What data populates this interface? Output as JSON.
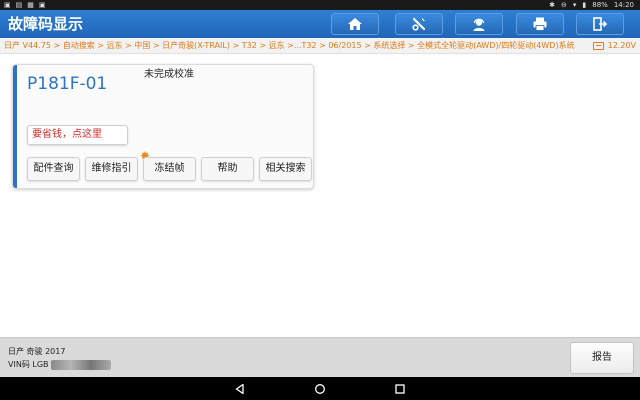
{
  "status_bar": {
    "left_icons": [
      "notification-icon",
      "screenshot-icon",
      "image-icon",
      "notification-icon"
    ],
    "battery_percent": "88%",
    "time": "14:20"
  },
  "header": {
    "title": "故障码显示",
    "buttons": [
      "home-icon",
      "diagnose-tool-icon",
      "support-icon",
      "print-icon",
      "exit-icon"
    ]
  },
  "breadcrumb": {
    "path": "日产 V44.75 > 自动搜索 > 远东 > 中国 > 日产奇骏(X-TRAIL) > T32 > 远东 >...T32 > 06/2015 > 系统选择 > 全模式全轮驱动(AWD)/四轮驱动(4WD)系统",
    "voltage": "12.20V"
  },
  "dtc": {
    "code": "P181F-01",
    "description": "未完成校准",
    "save_money_label": "要省钱，点这里",
    "actions": [
      "配件查询",
      "维修指引",
      "冻结帧",
      "帮助",
      "相关搜索"
    ]
  },
  "footer": {
    "vehicle": "日产 奇骏 2017",
    "vin_label": "VIN码 LGB",
    "report_label": "报告"
  },
  "colors": {
    "header_blue": "#1f66b8",
    "accent_blue": "#2b74c8",
    "breadcrumb_orange": "#e07a18",
    "promo_red": "#d12b2b"
  }
}
